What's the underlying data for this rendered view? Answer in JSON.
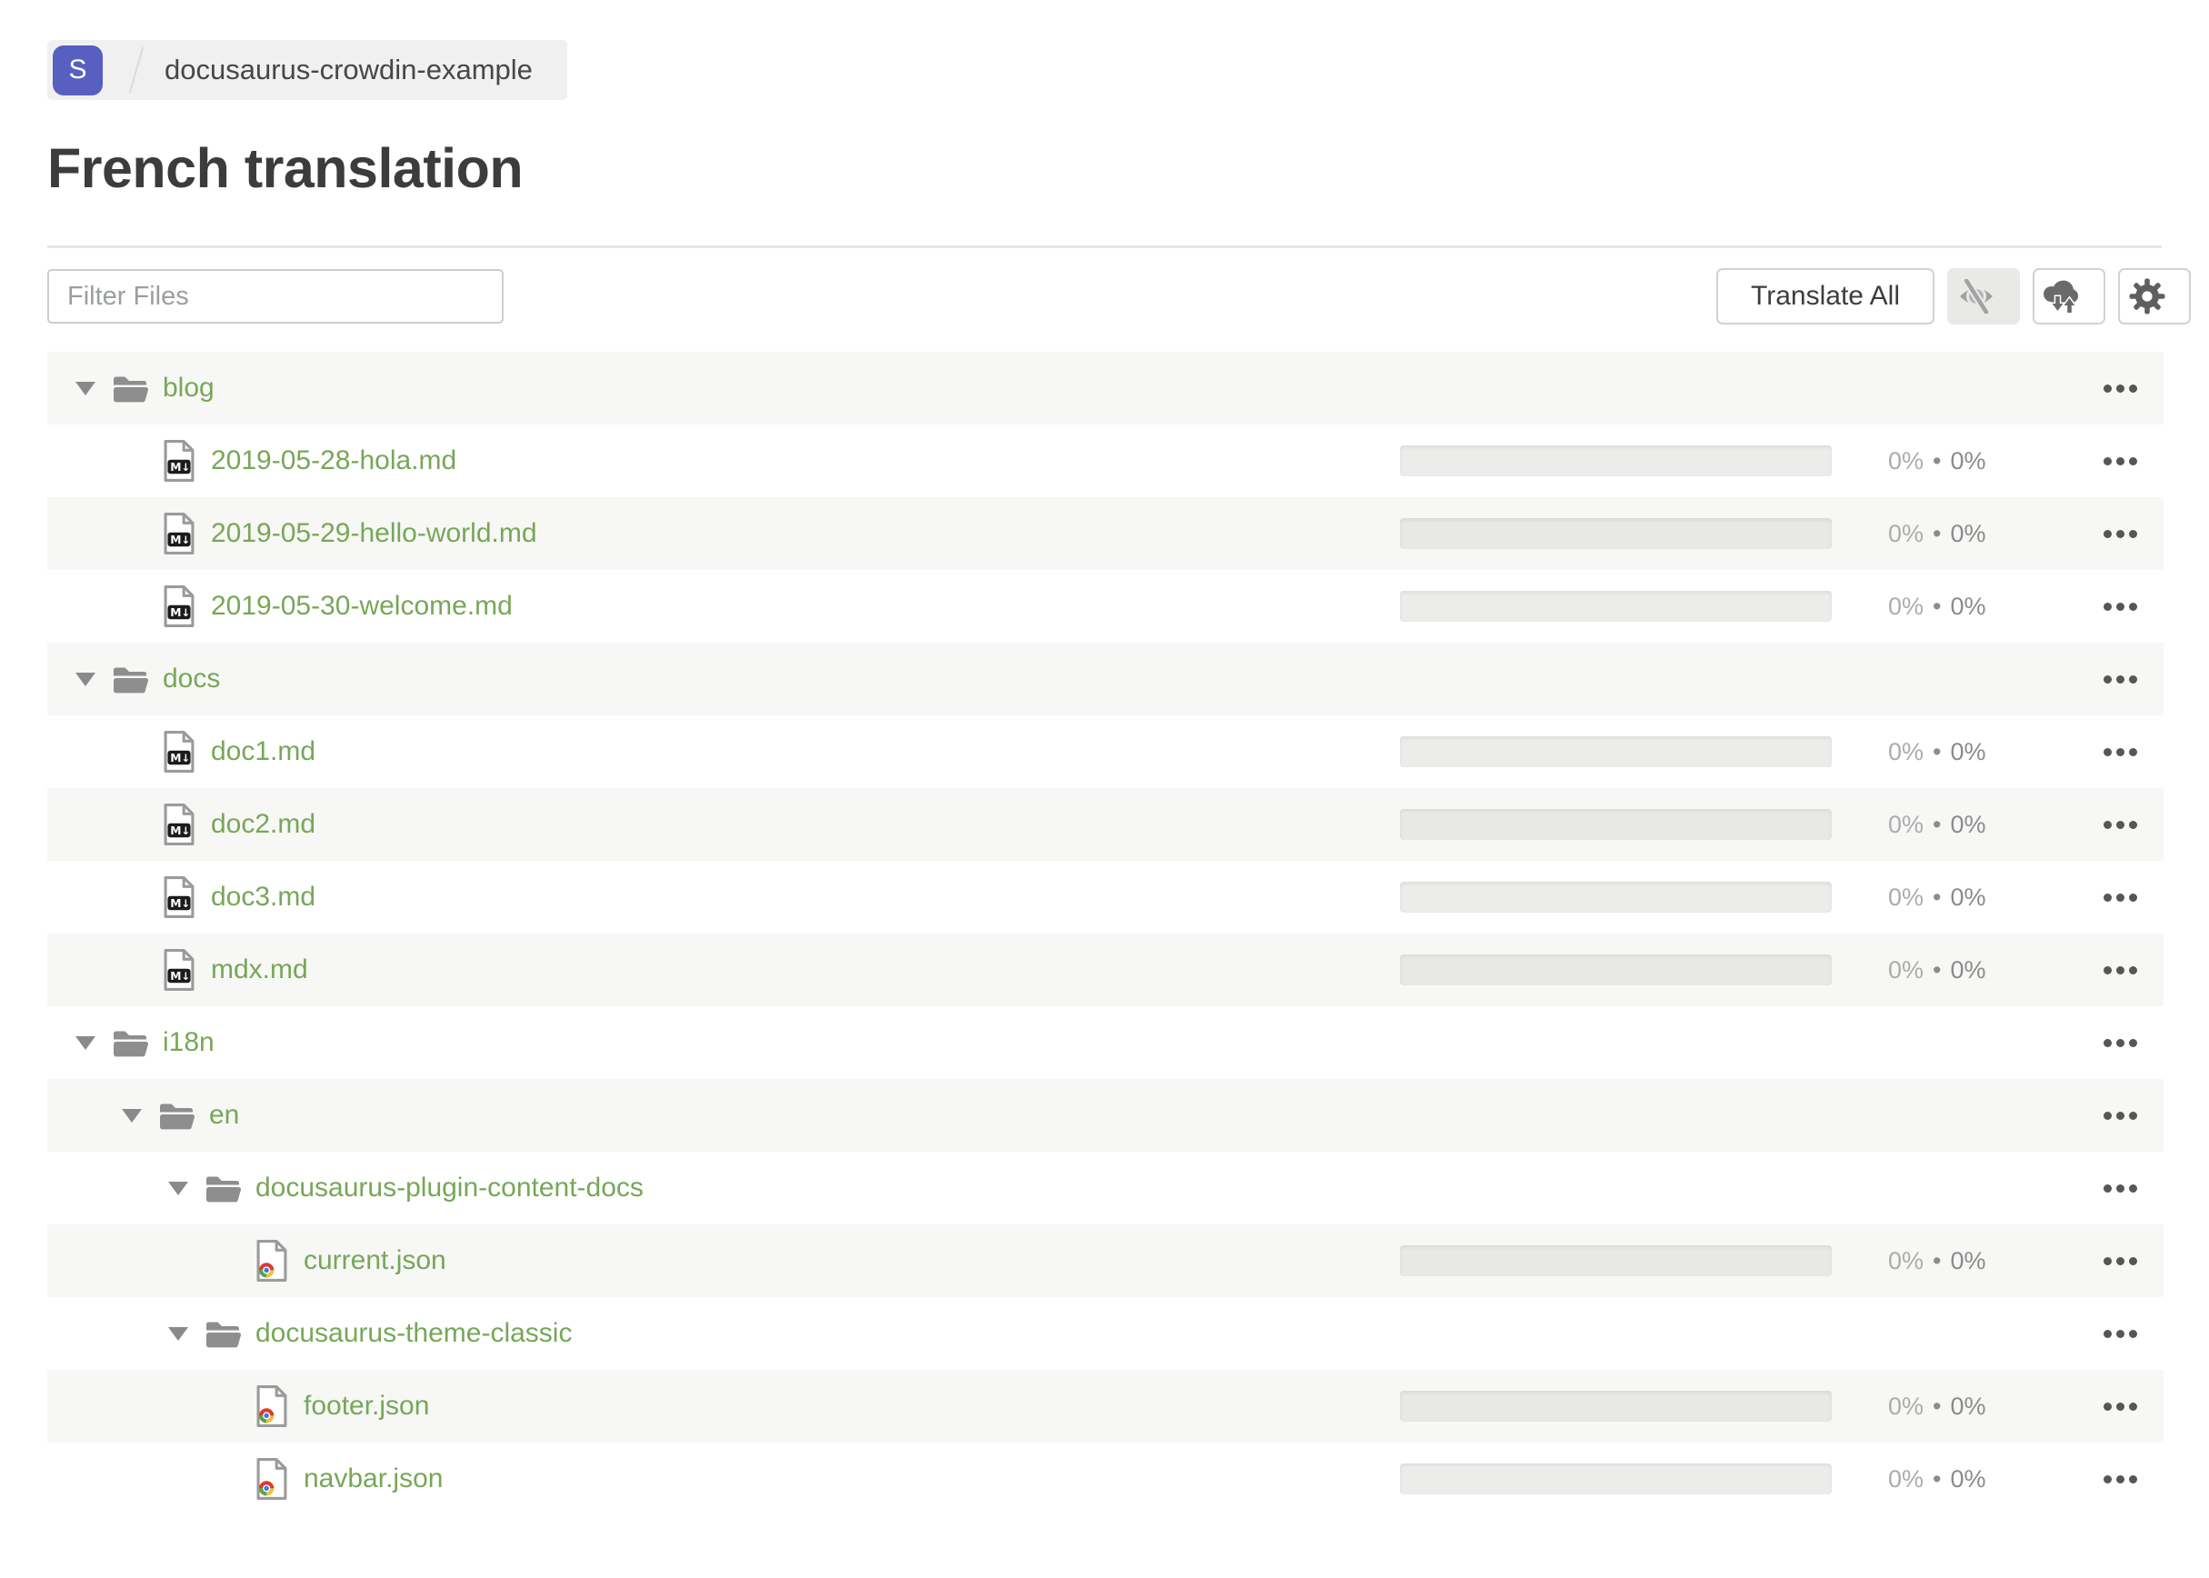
{
  "breadcrumb": {
    "project_initial": "S",
    "project_name": "docusaurus-crowdin-example"
  },
  "page": {
    "title": "French translation"
  },
  "toolbar": {
    "filter_placeholder": "Filter Files",
    "translate_all_label": "Translate All",
    "icon_buttons": [
      {
        "icon": "visibility-off-icon",
        "state": "active"
      },
      {
        "icon": "cloud-sync-icon",
        "state": "default"
      },
      {
        "icon": "settings-gear-icon",
        "state": "default"
      }
    ]
  },
  "colors": {
    "accent_green": "#77a758",
    "badge_indigo": "#575fc0",
    "row_stripe": "#f7f7f5",
    "progress_track": "#ececea",
    "icon_gray": "#8e8e8e",
    "percent_light": "#acacac",
    "percent_dark": "#8b8b8b",
    "menu_dots": "#565656"
  },
  "tree": {
    "percent_separator": "•",
    "rows": [
      {
        "type": "folder",
        "icon": "folder",
        "label": "blog",
        "level": 0,
        "expanded": true
      },
      {
        "type": "file",
        "icon": "markdown",
        "label": "2019-05-28-hola.md",
        "level": 1,
        "progress": 0,
        "translated": "0%",
        "approved": "0%"
      },
      {
        "type": "file",
        "icon": "markdown",
        "label": "2019-05-29-hello-world.md",
        "level": 1,
        "progress": 0,
        "translated": "0%",
        "approved": "0%"
      },
      {
        "type": "file",
        "icon": "markdown",
        "label": "2019-05-30-welcome.md",
        "level": 1,
        "progress": 0,
        "translated": "0%",
        "approved": "0%"
      },
      {
        "type": "folder",
        "icon": "folder",
        "label": "docs",
        "level": 0,
        "expanded": true
      },
      {
        "type": "file",
        "icon": "markdown",
        "label": "doc1.md",
        "level": 1,
        "progress": 0,
        "translated": "0%",
        "approved": "0%"
      },
      {
        "type": "file",
        "icon": "markdown",
        "label": "doc2.md",
        "level": 1,
        "progress": 0,
        "translated": "0%",
        "approved": "0%"
      },
      {
        "type": "file",
        "icon": "markdown",
        "label": "doc3.md",
        "level": 1,
        "progress": 0,
        "translated": "0%",
        "approved": "0%"
      },
      {
        "type": "file",
        "icon": "markdown",
        "label": "mdx.md",
        "level": 1,
        "progress": 0,
        "translated": "0%",
        "approved": "0%"
      },
      {
        "type": "folder",
        "icon": "folder",
        "label": "i18n",
        "level": 0,
        "expanded": true
      },
      {
        "type": "folder",
        "icon": "folder",
        "label": "en",
        "level": 1,
        "expanded": true
      },
      {
        "type": "folder",
        "icon": "folder",
        "label": "docusaurus-plugin-content-docs",
        "level": 2,
        "expanded": true
      },
      {
        "type": "file",
        "icon": "json",
        "label": "current.json",
        "level": 3,
        "progress": 0,
        "translated": "0%",
        "approved": "0%"
      },
      {
        "type": "folder",
        "icon": "folder",
        "label": "docusaurus-theme-classic",
        "level": 2,
        "expanded": true
      },
      {
        "type": "file",
        "icon": "json",
        "label": "footer.json",
        "level": 3,
        "progress": 0,
        "translated": "0%",
        "approved": "0%"
      },
      {
        "type": "file",
        "icon": "json",
        "label": "navbar.json",
        "level": 3,
        "progress": 0,
        "translated": "0%",
        "approved": "0%"
      }
    ]
  }
}
